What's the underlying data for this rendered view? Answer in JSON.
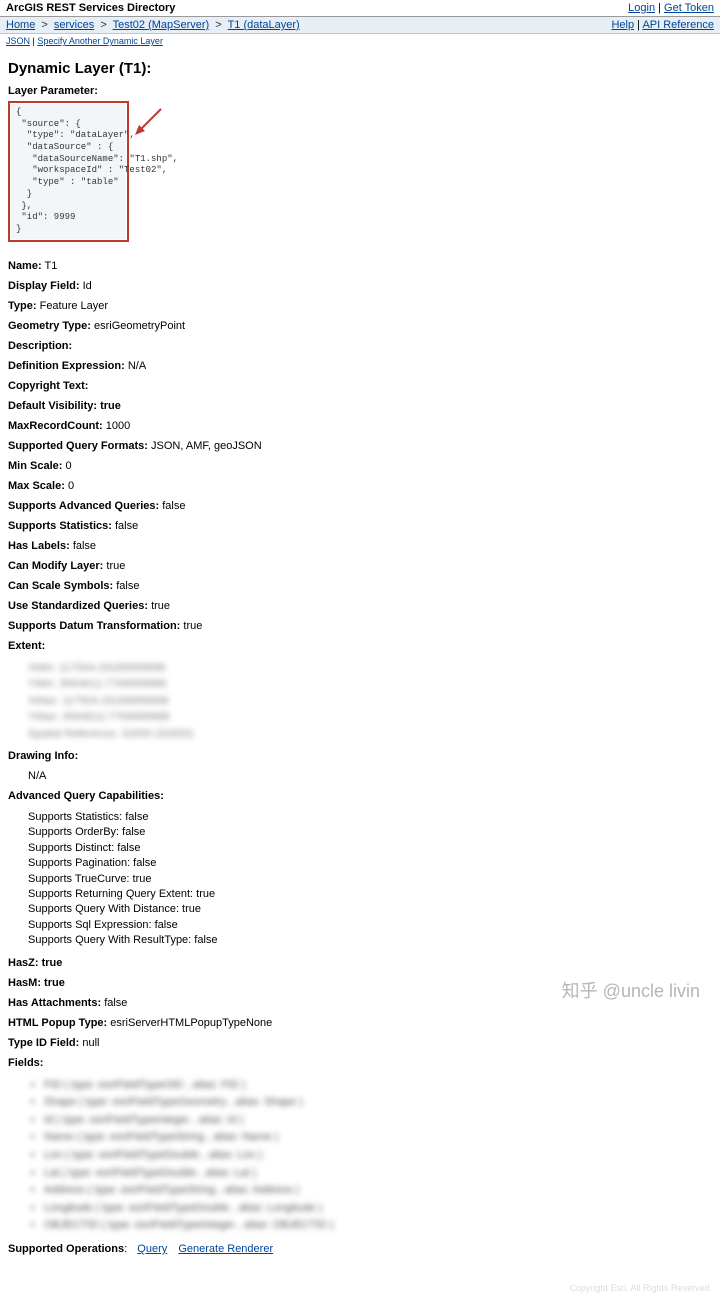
{
  "topbar": {
    "title": "ArcGIS REST Services Directory",
    "login": "Login",
    "get_token": "Get Token"
  },
  "breadcrumb": {
    "home": "Home",
    "services": "services",
    "service": "Test02 (MapServer)",
    "layer": "T1 (dataLayer)",
    "help": "Help",
    "api_ref": "API Reference"
  },
  "subtools": {
    "json": "JSON",
    "specify": "Specify Another Dynamic Layer"
  },
  "page": {
    "title": "Dynamic Layer (T1)",
    "layer_param_label": "Layer Parameter:",
    "json_payload": "{\n \"source\": {\n  \"type\": \"dataLayer\",\n  \"dataSource\" : {\n   \"dataSourceName\": \"T1.shp\",\n   \"workspaceId\" : \"Test02\",\n   \"type\" : \"table\"\n  }\n },\n \"id\": 9999\n}"
  },
  "props": {
    "name_label": "Name:",
    "name_val": "T1",
    "display_field_label": "Display Field:",
    "display_field_val": "Id",
    "type_label": "Type:",
    "type_val": "Feature Layer",
    "geometry_type_label": "Geometry Type:",
    "geometry_type_val": "esriGeometryPoint",
    "description_label": "Description:",
    "description_val": "",
    "def_expr_label": "Definition Expression:",
    "def_expr_val": "N/A",
    "copyright_label": "Copyright Text:",
    "copyright_val": "",
    "default_vis_label": "Default Visibility: true",
    "max_record_label": "MaxRecordCount:",
    "max_record_val": "1000",
    "query_formats_label": "Supported Query Formats:",
    "query_formats_val": "JSON, AMF, geoJSON",
    "min_scale_label": "Min Scale:",
    "min_scale_val": "0",
    "max_scale_label": "Max Scale:",
    "max_scale_val": "0",
    "adv_queries_label": "Supports Advanced Queries:",
    "adv_queries_val": "false",
    "stats_label": "Supports Statistics:",
    "stats_val": "false",
    "has_labels_label": "Has Labels:",
    "has_labels_val": "false",
    "can_modify_label": "Can Modify Layer:",
    "can_modify_val": "true",
    "can_scale_label": "Can Scale Symbols:",
    "can_scale_val": "false",
    "std_queries_label": "Use Standardized Queries:",
    "std_queries_val": "true",
    "datum_label": "Supports Datum Transformation:",
    "datum_val": "true",
    "extent_label": "Extent:",
    "drawing_info_label": "Drawing Info:",
    "drawing_info_val": "N/A",
    "adv_caps_label": "Advanced Query Capabilities:",
    "hasz_label": "HasZ: true",
    "hasm_label": "HasM: true",
    "has_attach_label": "Has Attachments:",
    "has_attach_val": "false",
    "html_popup_label": "HTML Popup Type:",
    "html_popup_val": "esriServerHTMLPopupTypeNone",
    "type_id_label": "Type ID Field:",
    "type_id_val": "null",
    "fields_label": "Fields:",
    "supported_ops_label": "Supported Operations",
    "op_query": "Query",
    "op_renderer": "Generate Renderer"
  },
  "adv_caps": {
    "c1": "Supports Statistics: false",
    "c2": "Supports OrderBy: false",
    "c3": "Supports Distinct: false",
    "c4": "Supports Pagination: false",
    "c5": "Supports TrueCurve: true",
    "c6": "Supports Returning Query Extent: true",
    "c7": "Supports Query With Distance: true",
    "c8": "Supports Sql Expression: false",
    "c9": "Supports Query With ResultType: false"
  },
  "watermark": "知乎 @uncle livin"
}
